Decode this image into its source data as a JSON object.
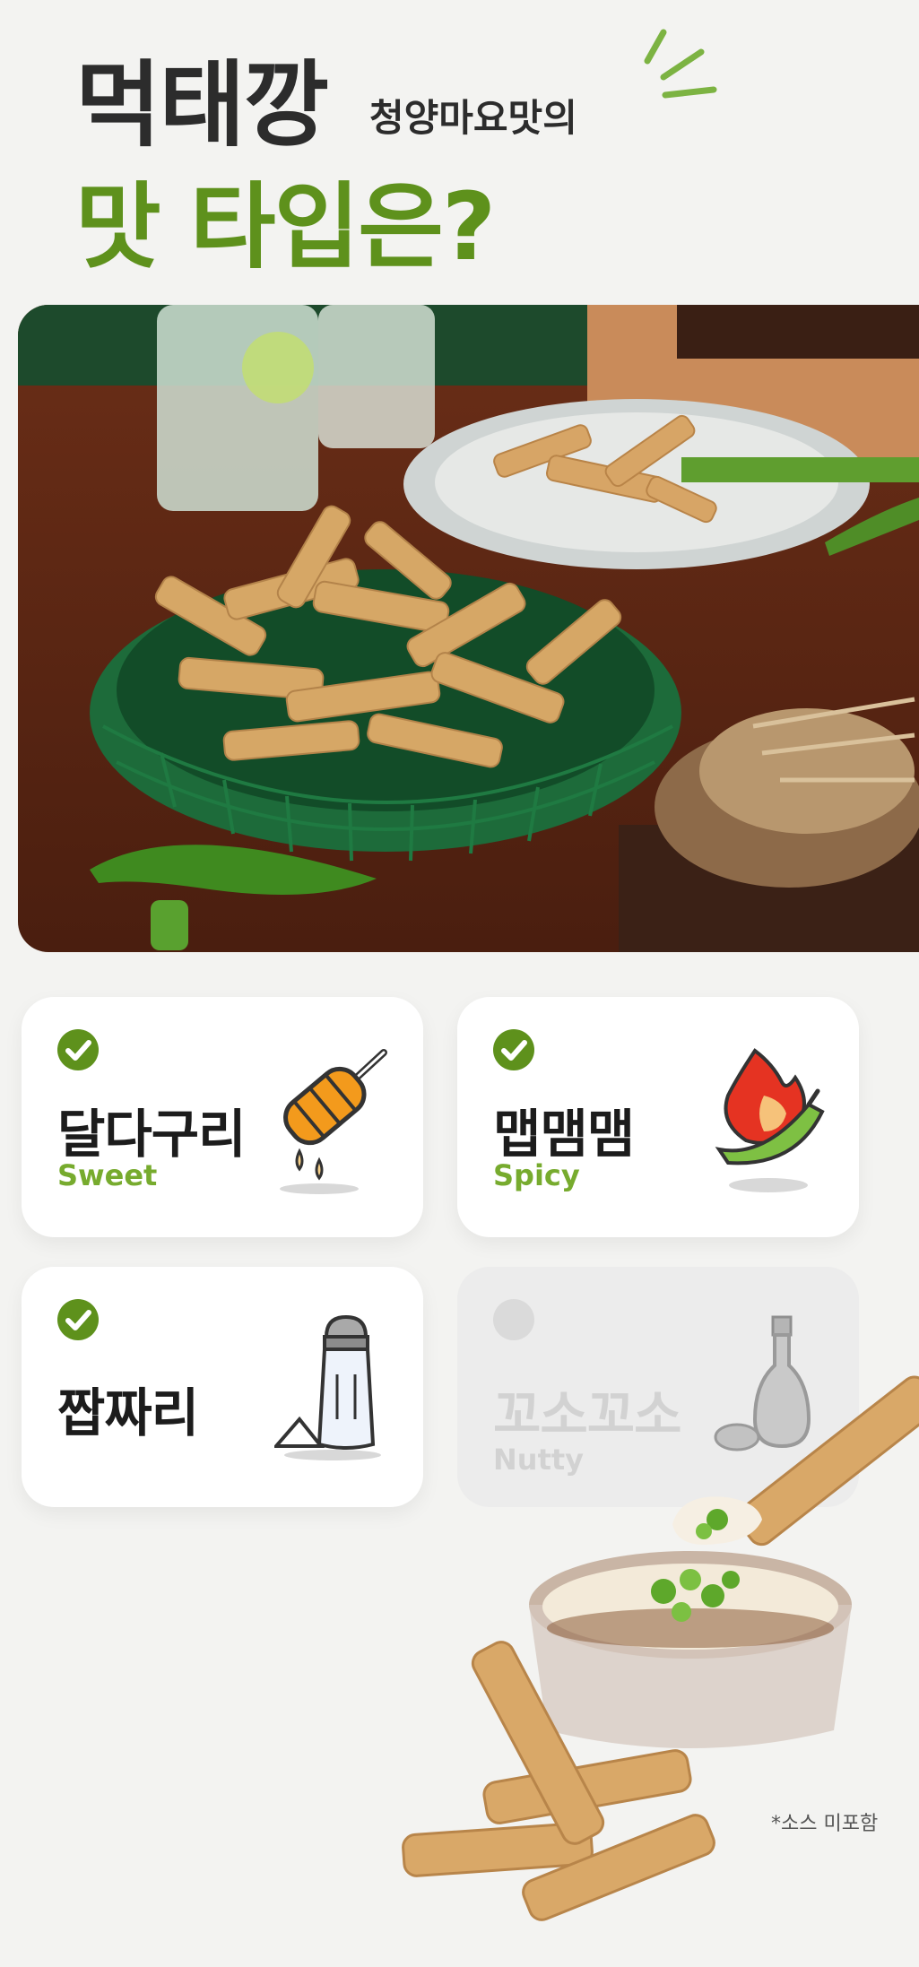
{
  "header": {
    "brand": "먹태깡",
    "flavor": "청양마요맛의",
    "question": "맛 타입은?"
  },
  "hero": {
    "image_icon": "snack-basket-photo-icon"
  },
  "taste_cards": [
    {
      "title": "달다구리",
      "subtitle": "Sweet",
      "icon": "honey-dipper-icon",
      "active": true
    },
    {
      "title": "맵맴맴",
      "subtitle": "Spicy",
      "icon": "chili-pepper-icon",
      "active": true
    },
    {
      "title": "짭짜리",
      "subtitle": "",
      "icon": "salt-shaker-icon",
      "active": true
    },
    {
      "title": "꼬소꼬소",
      "subtitle": "Nutty",
      "icon": "oil-bottle-icon",
      "active": false
    }
  ],
  "footer": {
    "note": "*소스 미포함"
  },
  "colors": {
    "accent_green": "#5e911c",
    "sub_green": "#77ab2e",
    "background": "#f3f3f1"
  }
}
